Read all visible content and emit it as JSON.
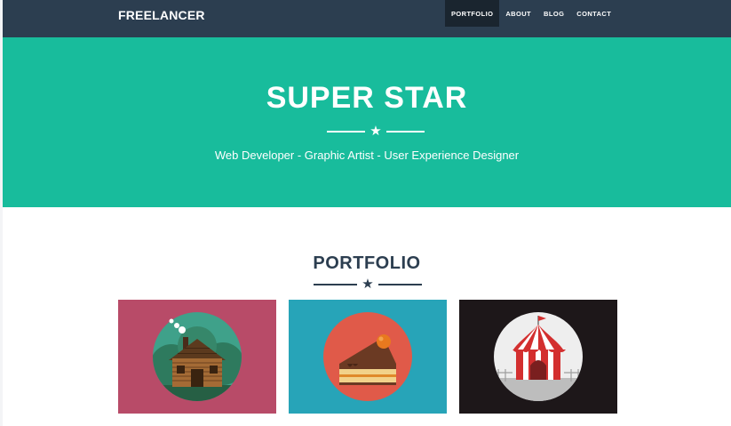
{
  "navbar": {
    "brand": "FREELANCER",
    "links": [
      {
        "label": "PORTFOLIO",
        "active": true
      },
      {
        "label": "ABOUT",
        "active": false
      },
      {
        "label": "BLOG",
        "active": false
      },
      {
        "label": "CONTACT",
        "active": false
      }
    ]
  },
  "hero": {
    "title": "SUPER STAR",
    "subtitle": "Web Developer - Graphic Artist - User Experience Designer"
  },
  "portfolio": {
    "title": "PORTFOLIO",
    "items": [
      {
        "icon": "cabin-icon",
        "background": "#b84b68"
      },
      {
        "icon": "cake-icon",
        "background": "#27a4b8"
      },
      {
        "icon": "circus-tent-icon",
        "background": "#1d1719"
      }
    ]
  },
  "colors": {
    "navbar": "#2c3e50",
    "navbar_active": "#1a252f",
    "hero": "#18bc9c",
    "heading": "#2c3e50"
  }
}
